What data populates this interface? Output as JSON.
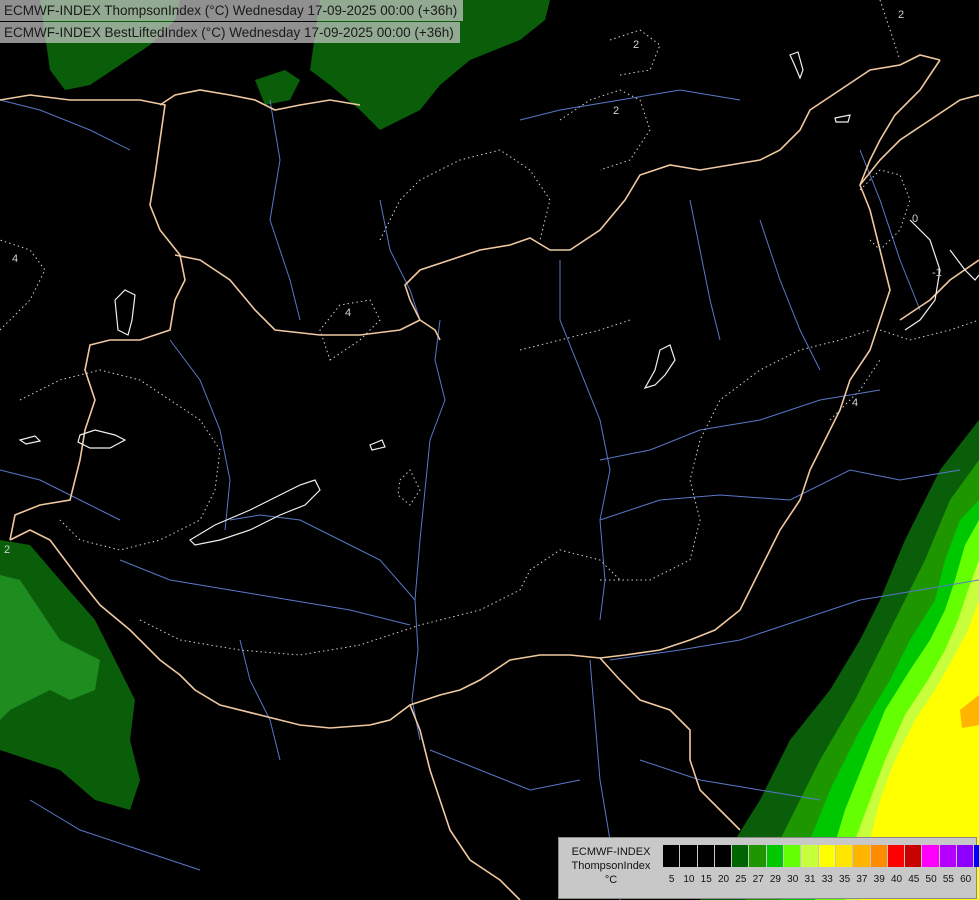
{
  "header": {
    "line1": "ECMWF-INDEX ThompsonIndex (°C) Wednesday 17-09-2025 00:00 (+36h)",
    "line2": "ECMWF-INDEX BestLiftedIndex (°C) Wednesday 17-09-2025 00:00 (+36h)"
  },
  "legend": {
    "source": "ECMWF-INDEX",
    "parameter": "ThompsonIndex",
    "unit": "°C",
    "colors": [
      "#000000",
      "#000000",
      "#000000",
      "#000000",
      "#006400",
      "#1e9600",
      "#00c800",
      "#64ff00",
      "#c8ff3c",
      "#ffff00",
      "#ffe600",
      "#ffb400",
      "#ff8c00",
      "#ff0000",
      "#c80000",
      "#ff00ff",
      "#b400ff",
      "#8c00ff",
      "#0000ff"
    ],
    "ticks": [
      "5",
      "10",
      "15",
      "20",
      "25",
      "27",
      "29",
      "30",
      "31",
      "33",
      "35",
      "37",
      "39",
      "40",
      "45",
      "50",
      "55",
      "60"
    ]
  },
  "contour_labels": [
    "2",
    "2",
    "4",
    "4",
    "4",
    "2",
    "0",
    "-1",
    "2"
  ],
  "map_colors": {
    "background": "#000000",
    "border": "#f0c8a0",
    "river": "#5a78c8",
    "isoline": "#d8d8d8"
  }
}
